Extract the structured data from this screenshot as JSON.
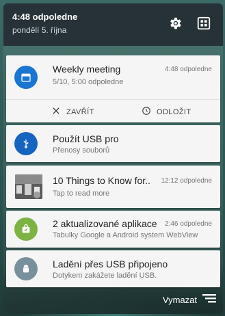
{
  "header": {
    "time": "4:48 odpoledne",
    "date": "pondělí 5. října"
  },
  "notifications": [
    {
      "title": "Weekly meeting",
      "subtitle": "5/10, 5:00 odpoledne",
      "time": "4:48 odpoledne",
      "icon": "calendar-icon",
      "color": "#1976d2",
      "actions": [
        {
          "label": "ZAVŘÍT",
          "icon": "close-icon"
        },
        {
          "label": "ODLOŽIT",
          "icon": "snooze-clock-icon"
        }
      ]
    },
    {
      "title": "Použít USB pro",
      "subtitle": "Přenosy souborů",
      "icon": "usb-icon",
      "color": "#1565c0"
    },
    {
      "title": "10 Things to Know for..",
      "subtitle": "Tap to read more",
      "time": "12:12 odpoledne",
      "icon": "news-thumbnail"
    },
    {
      "title": "2 aktualizované aplikace",
      "subtitle": "Tabulky Google a Android system WebView",
      "time": "2:46 odpoledne",
      "icon": "play-store-update-icon",
      "color": "#7cb342"
    },
    {
      "title": "Ladění přes USB připojeno",
      "subtitle": "Dotykem zakážete ladění USB.",
      "icon": "android-debug-icon",
      "color": "#607d8b"
    }
  ],
  "footer": {
    "clear_label": "Vymazat"
  }
}
